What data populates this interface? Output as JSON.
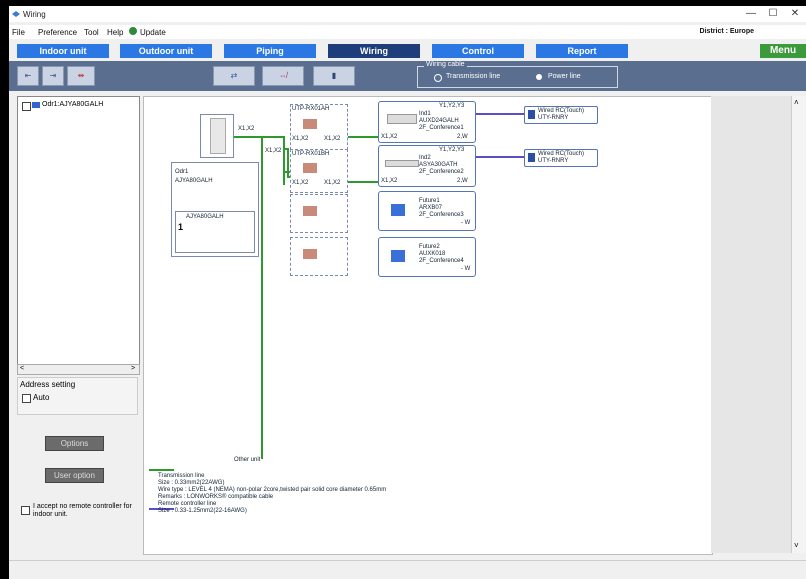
{
  "window": {
    "title": "Wiring",
    "minimize": "—",
    "maximize": "☐",
    "close": "✕"
  },
  "menubar": {
    "items": [
      "File",
      "Preference",
      "Tool",
      "Help",
      "Update"
    ],
    "district": "District : Europe"
  },
  "nav": {
    "tabs": [
      "Indoor unit",
      "Outdoor unit",
      "Piping",
      "Wiring",
      "Control",
      "Report"
    ],
    "menu": "Menu"
  },
  "toolbar": {
    "wiring_cable_label": "Wiring cable",
    "transmission_line": "Transmission line",
    "power_line": "Power line"
  },
  "left_panel": {
    "tree_item": "Odr1:AJYA80GALH",
    "scroll_left": "<",
    "scroll_right": ">",
    "address_setting": "Address setting",
    "auto_label": "Auto",
    "options_button": "Options",
    "user_option_button": "User option",
    "accept_label": "I accept no remote controller for indoor unit."
  },
  "canvas": {
    "outdoor": {
      "name": "Odr1",
      "model": "AJYA80GALH",
      "inner_model": "AJYA80GALH",
      "count": "1"
    },
    "outdoor_terminal": "X1,X2",
    "branch_terminal": "X1,X2",
    "utp1": {
      "name": "UTP-RX01AH",
      "t_left": "X1,X2",
      "t_right": "X1,X2"
    },
    "utp2": {
      "name": "UTP-RX01BH",
      "t_left": "X1,X2",
      "t_right": "X1,X2"
    },
    "indoor1": {
      "name": "Ind1",
      "model": "AUXD24GALH",
      "location": "2F_Conference1",
      "terminal": "Y1,Y2,Y3",
      "t_left": "X1,X2",
      "w": "2,W"
    },
    "indoor2": {
      "name": "Ind2",
      "model": "ASYA30GATH",
      "location": "2F_Conference2",
      "terminal": "Y1,Y2,Y3",
      "t_left": "X1,X2",
      "w": "2,W"
    },
    "future1": {
      "name": "Future1",
      "model": "ARXB07",
      "location": "2F_Conference3",
      "w": "- W"
    },
    "future2": {
      "name": "Future2",
      "model": "AUXK018",
      "location": "2F_Conference4",
      "w": "- W"
    },
    "remote1": {
      "name": "Wired RC(Touch)",
      "model": "UTY-RNRY"
    },
    "remote2": {
      "name": "Wired RC(Touch)",
      "model": "UTY-RNRY"
    },
    "other_unit": "Other unit",
    "notes": {
      "transmission_title": "Transmission line",
      "transmission_size": "Size : 0.33mm2(22AWG)",
      "wire_type": "Wire type : LEVEL 4 (NEMA) non-polar 2core,twisted pair solid core diameter 0.65mm",
      "remarks": "Remarks : LONWORKS® compatible cable",
      "remote_title": "Remote controller line",
      "remote_size": "Size : 0.33-1.25mm2(22-16AWG)"
    }
  },
  "colors": {
    "tab_blue": "#2b78e4",
    "tab_active": "#1d3e7a",
    "menu_green": "#3c9a3c",
    "wire_green": "#2e9a2e",
    "remote_line": "#5a4fc4"
  }
}
